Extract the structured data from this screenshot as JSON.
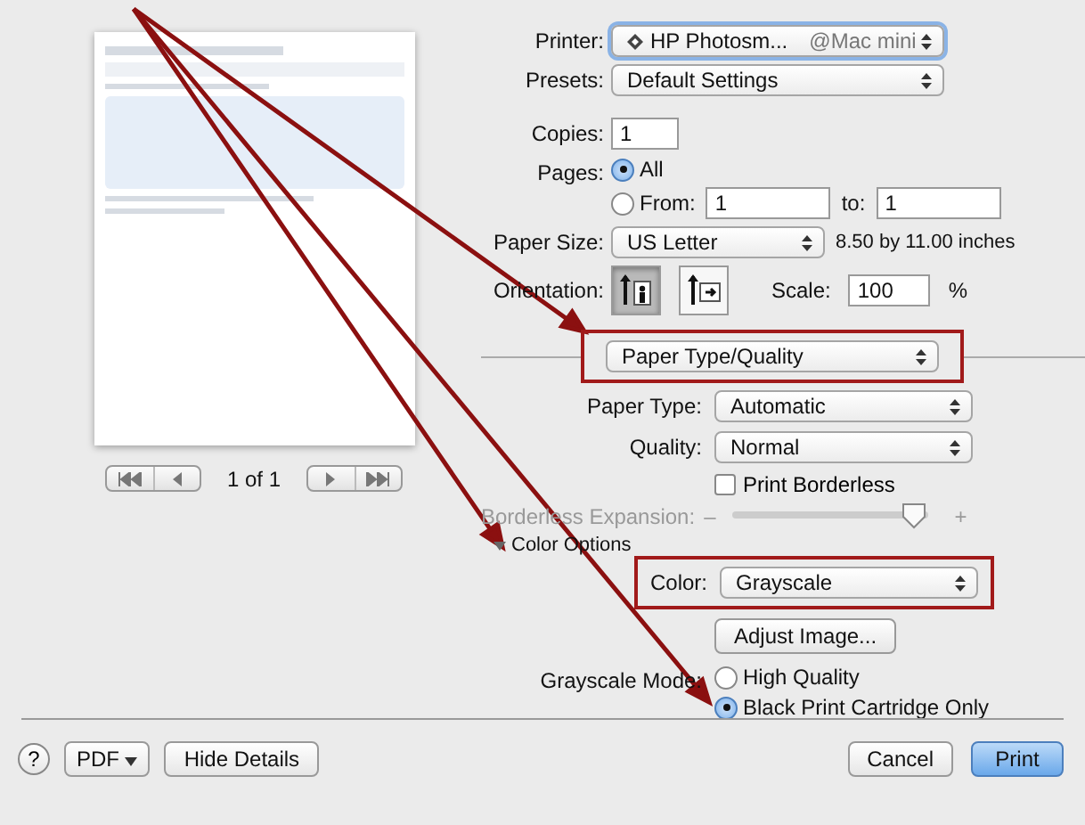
{
  "preview": {
    "page_indicator": "1 of 1"
  },
  "printer": {
    "label": "Printer:",
    "value": "HP Photosm...",
    "suffix": "@Mac mini"
  },
  "presets": {
    "label": "Presets:",
    "value": "Default Settings"
  },
  "copies": {
    "label": "Copies:",
    "value": "1"
  },
  "pages": {
    "label": "Pages:",
    "options": [
      {
        "label": "All",
        "selected": true
      },
      {
        "label": "From:",
        "selected": false
      }
    ],
    "from": "1",
    "to_label": "to:",
    "to": "1"
  },
  "paper_size": {
    "label": "Paper Size:",
    "value": "US Letter",
    "note": "8.50 by 11.00 inches"
  },
  "orientation": {
    "label": "Orientation:",
    "options": [
      {
        "kind": "portrait",
        "selected": true
      },
      {
        "kind": "landscape",
        "selected": false
      }
    ]
  },
  "scale": {
    "label": "Scale:",
    "value": "100",
    "unit": "%"
  },
  "panel_menu": {
    "value": "Paper Type/Quality",
    "highlighted": true
  },
  "paper_type": {
    "label": "Paper Type:",
    "value": "Automatic"
  },
  "quality": {
    "label": "Quality:",
    "value": "Normal"
  },
  "print_borderless": {
    "label": "Print Borderless",
    "checked": false
  },
  "borderless_expansion": {
    "label": "Borderless Expansion:",
    "minus": "–",
    "plus": "+",
    "level": 0.95,
    "disabled": true
  },
  "color_options": {
    "label": "Color Options",
    "expanded": true
  },
  "color": {
    "label": "Color:",
    "value": "Grayscale",
    "highlighted": true
  },
  "adjust_button": "Adjust Image...",
  "grayscale_mode": {
    "label": "Grayscale Mode:",
    "options": [
      {
        "label": "High Quality",
        "selected": false
      },
      {
        "label": "Black Print Cartridge Only",
        "selected": true
      }
    ]
  },
  "footer": {
    "help": "?",
    "pdf": "PDF",
    "hide_details": "Hide Details",
    "cancel": "Cancel",
    "print": "Print"
  }
}
